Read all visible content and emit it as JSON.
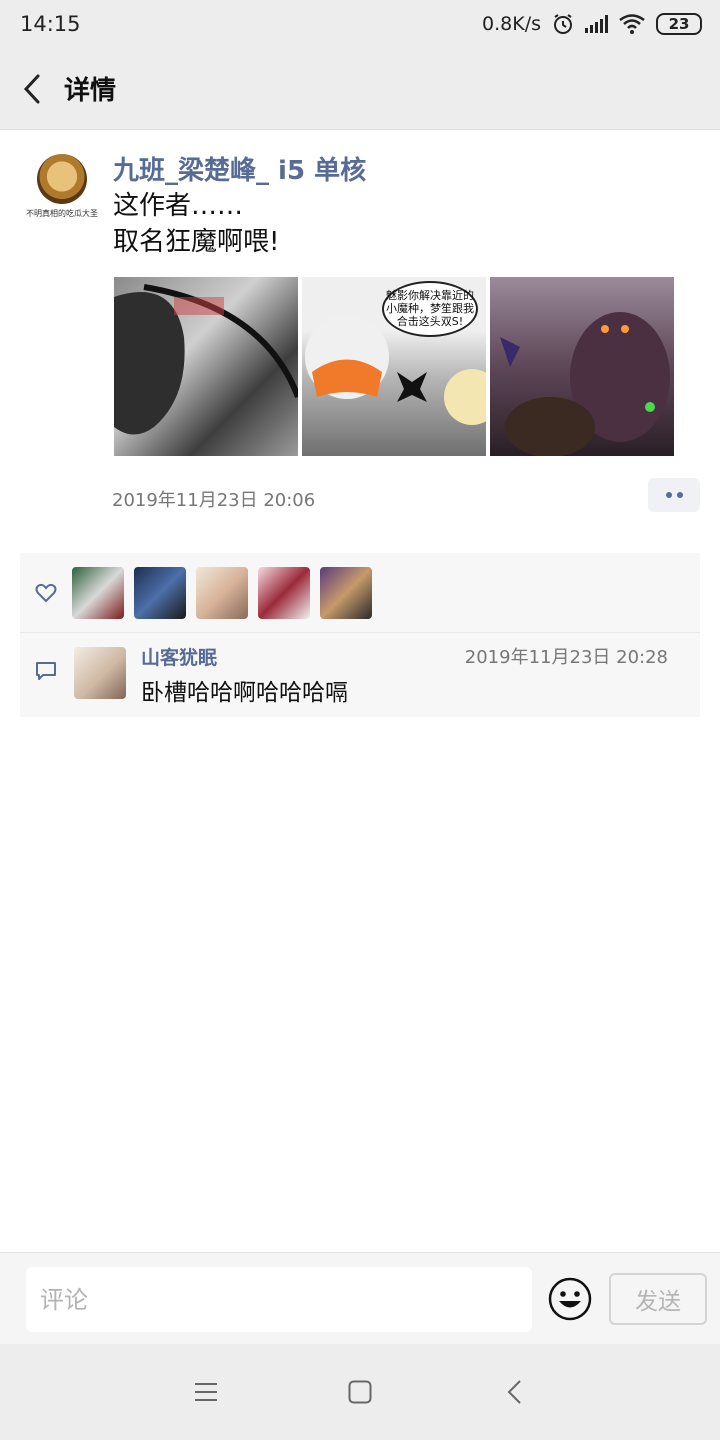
{
  "status_bar": {
    "time": "14:15",
    "net_speed": "0.8K/s",
    "battery": "23"
  },
  "header": {
    "title": "详情"
  },
  "post": {
    "author": "九班_梁楚峰_ i5 单核",
    "avatar_caption": "不明真相的吃瓜大圣",
    "text_lines": [
      "这作者……",
      "取名狂魔啊喂!"
    ],
    "image2_bubble": "魅影你解决靠近的小魔种，梦笙跟我合击这头双S!",
    "timestamp": "2019年11月23日 20:06"
  },
  "comments": [
    {
      "author": "山客犹眠",
      "time": "2019年11月23日 20:28",
      "text": "卧槽哈哈啊哈哈哈嗝"
    }
  ],
  "composer": {
    "placeholder": "评论",
    "send_label": "发送"
  },
  "colors": {
    "link": "#576b95",
    "bar_bg": "#ededed",
    "panel_bg": "#f7f7f7"
  }
}
